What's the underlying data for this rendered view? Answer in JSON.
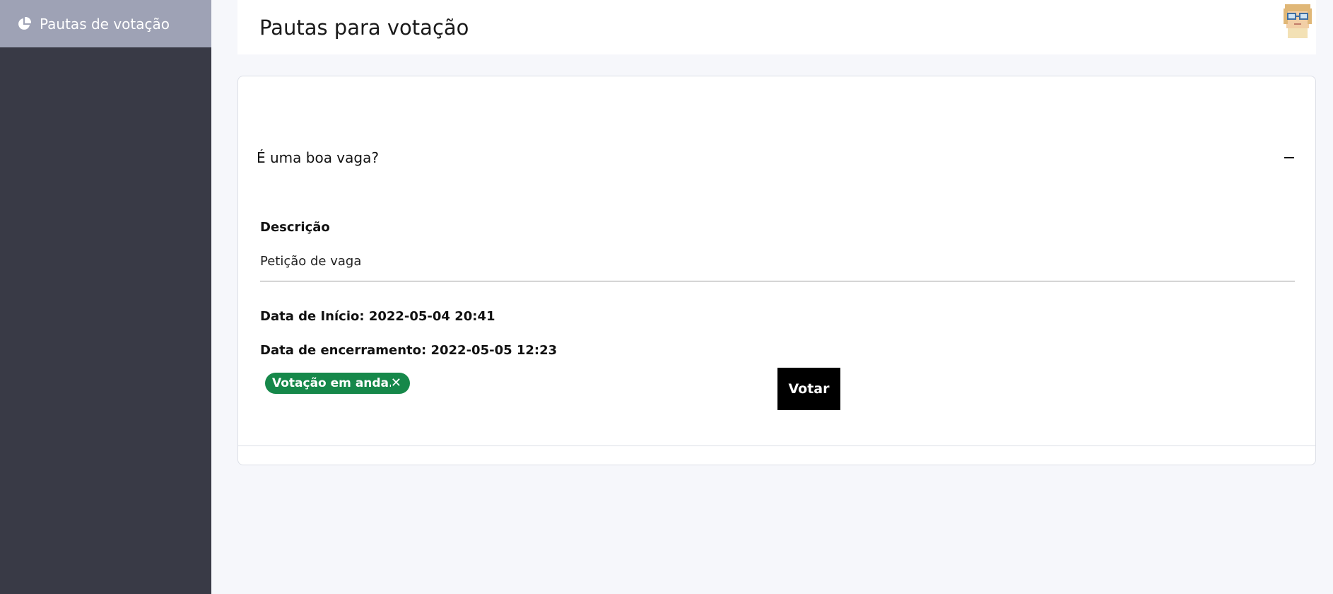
{
  "sidebar": {
    "items": [
      {
        "label": "Pautas de votação",
        "icon": "pie-chart-icon"
      }
    ]
  },
  "header": {
    "title": "Pautas para votação",
    "avatar": "avatar"
  },
  "agenda": {
    "question": "É uma boa vaga?",
    "description_label": "Descrição",
    "description_value": "Petição de vaga",
    "start_label": "Data de Início: 2022-05-04 20:41",
    "end_label": "Data de encerramento: 2022-05-05 12:23",
    "status_text": "Votação em anda...",
    "status_close": "✕",
    "vote_button": "Votar"
  },
  "colors": {
    "sidebar_bg": "#393a46",
    "sidebar_active": "#9ea2b5",
    "status_green": "#16884a",
    "vote_button": "#000000"
  }
}
